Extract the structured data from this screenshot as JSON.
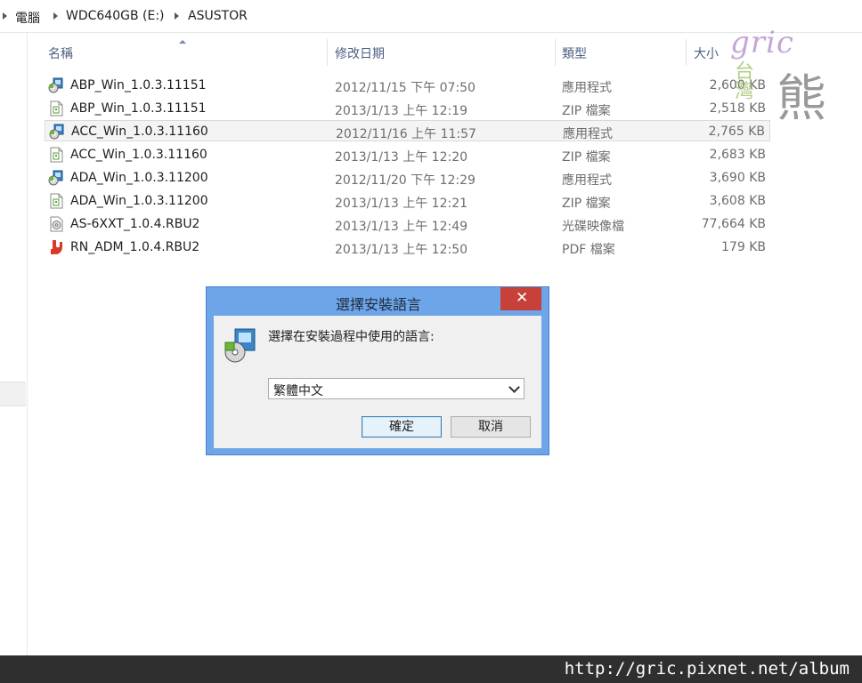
{
  "address": {
    "crumbs": [
      "電腦",
      "WDC640GB (E:)",
      "ASUSTOR"
    ]
  },
  "columns": {
    "name": "名稱",
    "date": "修改日期",
    "type": "類型",
    "size": "大小"
  },
  "files": [
    {
      "name": "ABP_Win_1.0.3.11151",
      "date": "2012/11/15 下午 07:50",
      "type": "應用程式",
      "size": "2,600 KB",
      "icon": "installer-icon"
    },
    {
      "name": "ABP_Win_1.0.3.11151",
      "date": "2013/1/13 上午 12:19",
      "type": "ZIP 檔案",
      "size": "2,518 KB",
      "icon": "zip-file-icon"
    },
    {
      "name": "ACC_Win_1.0.3.11160",
      "date": "2012/11/16 上午 11:57",
      "type": "應用程式",
      "size": "2,765 KB",
      "icon": "installer-icon"
    },
    {
      "name": "ACC_Win_1.0.3.11160",
      "date": "2013/1/13 上午 12:20",
      "type": "ZIP 檔案",
      "size": "2,683 KB",
      "icon": "zip-file-icon"
    },
    {
      "name": "ADA_Win_1.0.3.11200",
      "date": "2012/11/20 下午 12:29",
      "type": "應用程式",
      "size": "3,690 KB",
      "icon": "installer-icon"
    },
    {
      "name": "ADA_Win_1.0.3.11200",
      "date": "2013/1/13 上午 12:21",
      "type": "ZIP 檔案",
      "size": "3,608 KB",
      "icon": "zip-file-icon"
    },
    {
      "name": "AS-6XXT_1.0.4.RBU2",
      "date": "2013/1/13 上午 12:49",
      "type": "光碟映像檔",
      "size": "77,664 KB",
      "icon": "disc-image-icon"
    },
    {
      "name": "RN_ADM_1.0.4.RBU2",
      "date": "2013/1/13 上午 12:50",
      "type": "PDF 檔案",
      "size": "179 KB",
      "icon": "pdf-file-icon"
    }
  ],
  "watermark": {
    "gric": "gric",
    "tai": "台灣",
    "bear": "熊"
  },
  "dialog": {
    "title": "選擇安裝語言",
    "prompt": "選擇在安裝過程中使用的語言:",
    "selected_language": "繁體中文",
    "ok_label": "確定",
    "cancel_label": "取消"
  },
  "footer": {
    "url": "http://gric.pixnet.net/album"
  }
}
